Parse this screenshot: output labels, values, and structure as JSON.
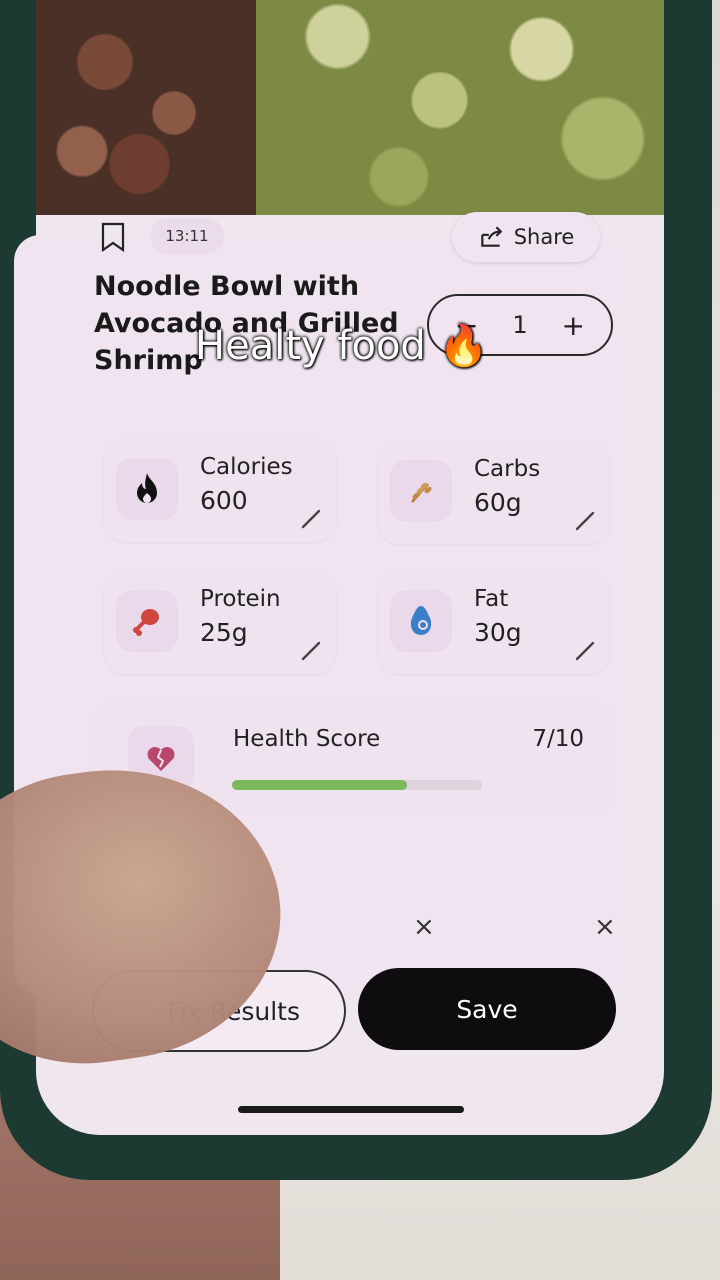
{
  "header": {
    "share_label": "Share",
    "time": "13:11"
  },
  "meal": {
    "title": "Noodle Bowl with Avocado and Grilled Shrimp",
    "quantity": "1",
    "minus": "−",
    "plus": "+"
  },
  "caption": {
    "text": "Healty food",
    "emoji": "🔥"
  },
  "macros": [
    {
      "label": "Calories",
      "value": "600",
      "icon": "flame-icon"
    },
    {
      "label": "Carbs",
      "value": "60g",
      "icon": "wheat-icon"
    },
    {
      "label": "Protein",
      "value": "25g",
      "icon": "drumstick-icon"
    },
    {
      "label": "Fat",
      "value": "30g",
      "icon": "avocado-icon"
    }
  ],
  "health": {
    "label": "Health Score",
    "score": "7/10",
    "progress": 0.7,
    "icon": "broken-heart-icon",
    "bar_color": "#7cb95a"
  },
  "actions": {
    "fix_label": "Fix Results",
    "save_label": "Save",
    "close_glyph": "×"
  }
}
